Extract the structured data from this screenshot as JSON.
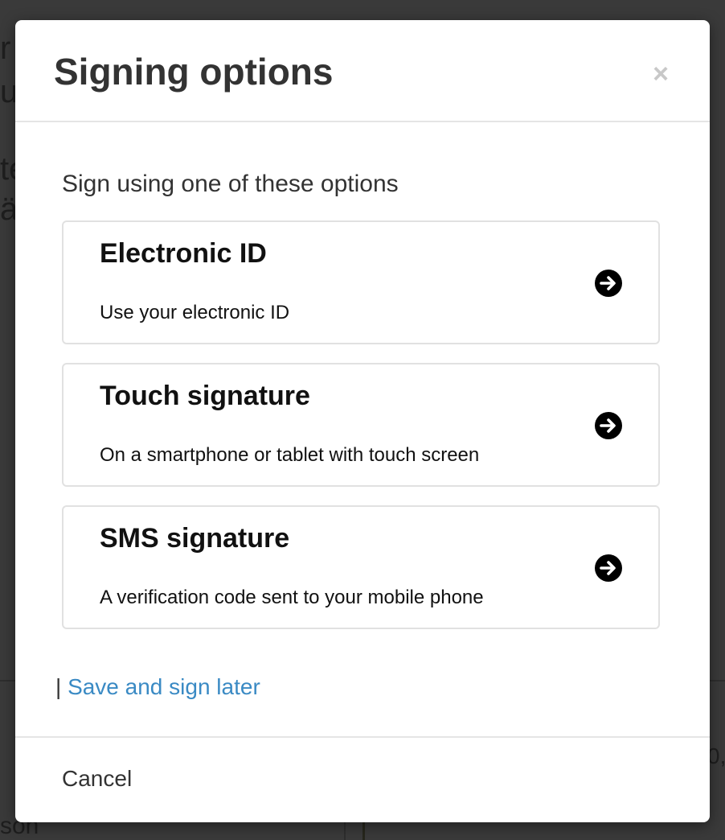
{
  "modal": {
    "title": "Signing options",
    "close_symbol": "×",
    "intro": "Sign using one of these options",
    "options": [
      {
        "title": "Electronic ID",
        "description": "Use your electronic ID",
        "icon": "arrow-right-circle-icon"
      },
      {
        "title": "Touch signature",
        "description": "On a smartphone or tablet with touch screen",
        "icon": "arrow-right-circle-icon"
      },
      {
        "title": "SMS signature",
        "description": "A verification code sent to your mobile phone",
        "icon": "arrow-right-circle-icon"
      }
    ],
    "separator": "|",
    "save_later_label": "Save and sign later",
    "cancel_label": "Cancel"
  },
  "colors": {
    "overlay": "#3a3a3a",
    "link": "#3a8ac4",
    "title_text": "#333333",
    "option_border": "#e1e1e1",
    "close_icon": "#c8c8c8"
  }
}
